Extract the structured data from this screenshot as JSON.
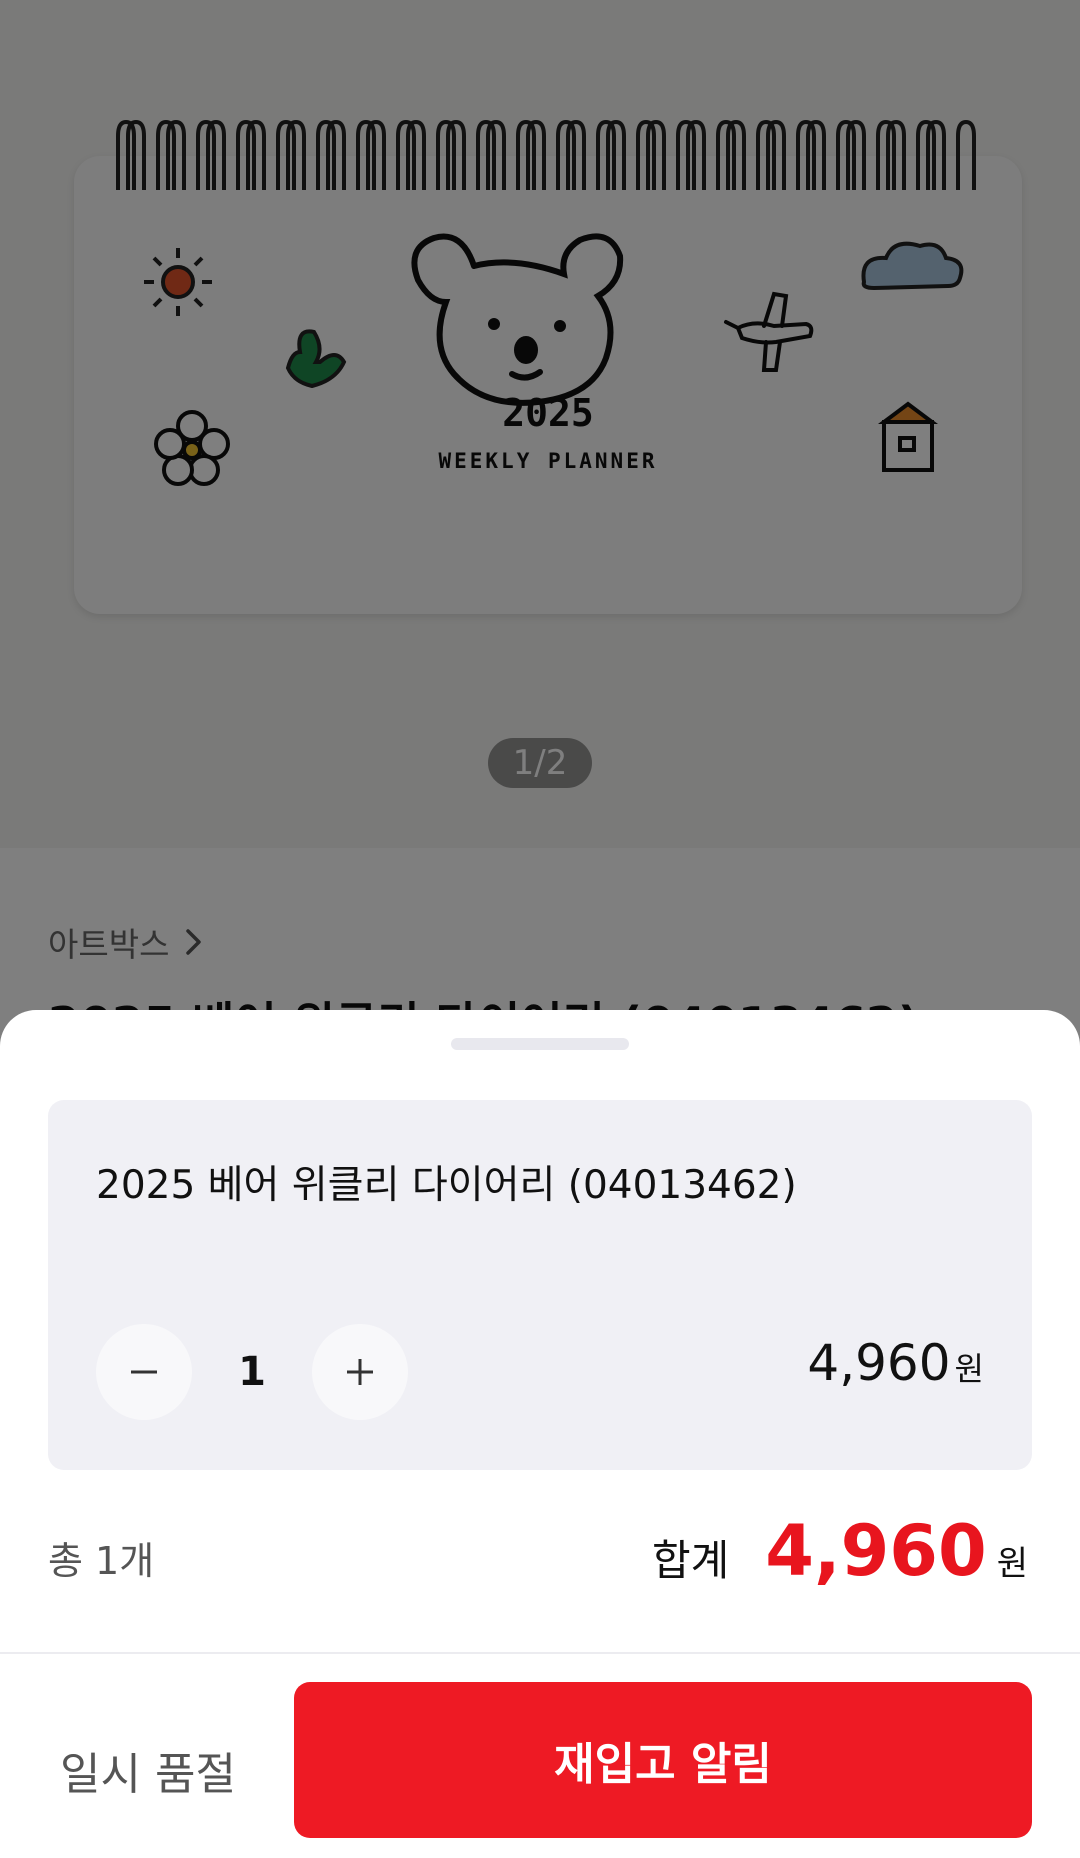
{
  "colors": {
    "accent_red": "#ee1a24",
    "price_red": "#e8151e",
    "option_box_bg": "#f0f0f5",
    "overlay": "rgba(0,0,0,0.5)"
  },
  "product_page": {
    "image_art": {
      "year": "2025",
      "caption": "WEEKLY PLANNER"
    },
    "image_pager": "1/2",
    "brand": "아트박스",
    "title": "2025 베어 위클리 다이어리 (04013462)"
  },
  "sheet": {
    "option": {
      "name": "2025 베어 위클리 다이어리 (04013462)",
      "quantity": "1",
      "price": "4,960",
      "price_unit": "원",
      "minus_icon": "minus-icon",
      "plus_icon": "plus-icon"
    },
    "summary": {
      "count": "총 1개",
      "total_label": "합계",
      "total_amount": "4,960",
      "total_unit": "원"
    },
    "footer": {
      "status": "일시 품절",
      "restock_button": "재입고 알림"
    }
  }
}
